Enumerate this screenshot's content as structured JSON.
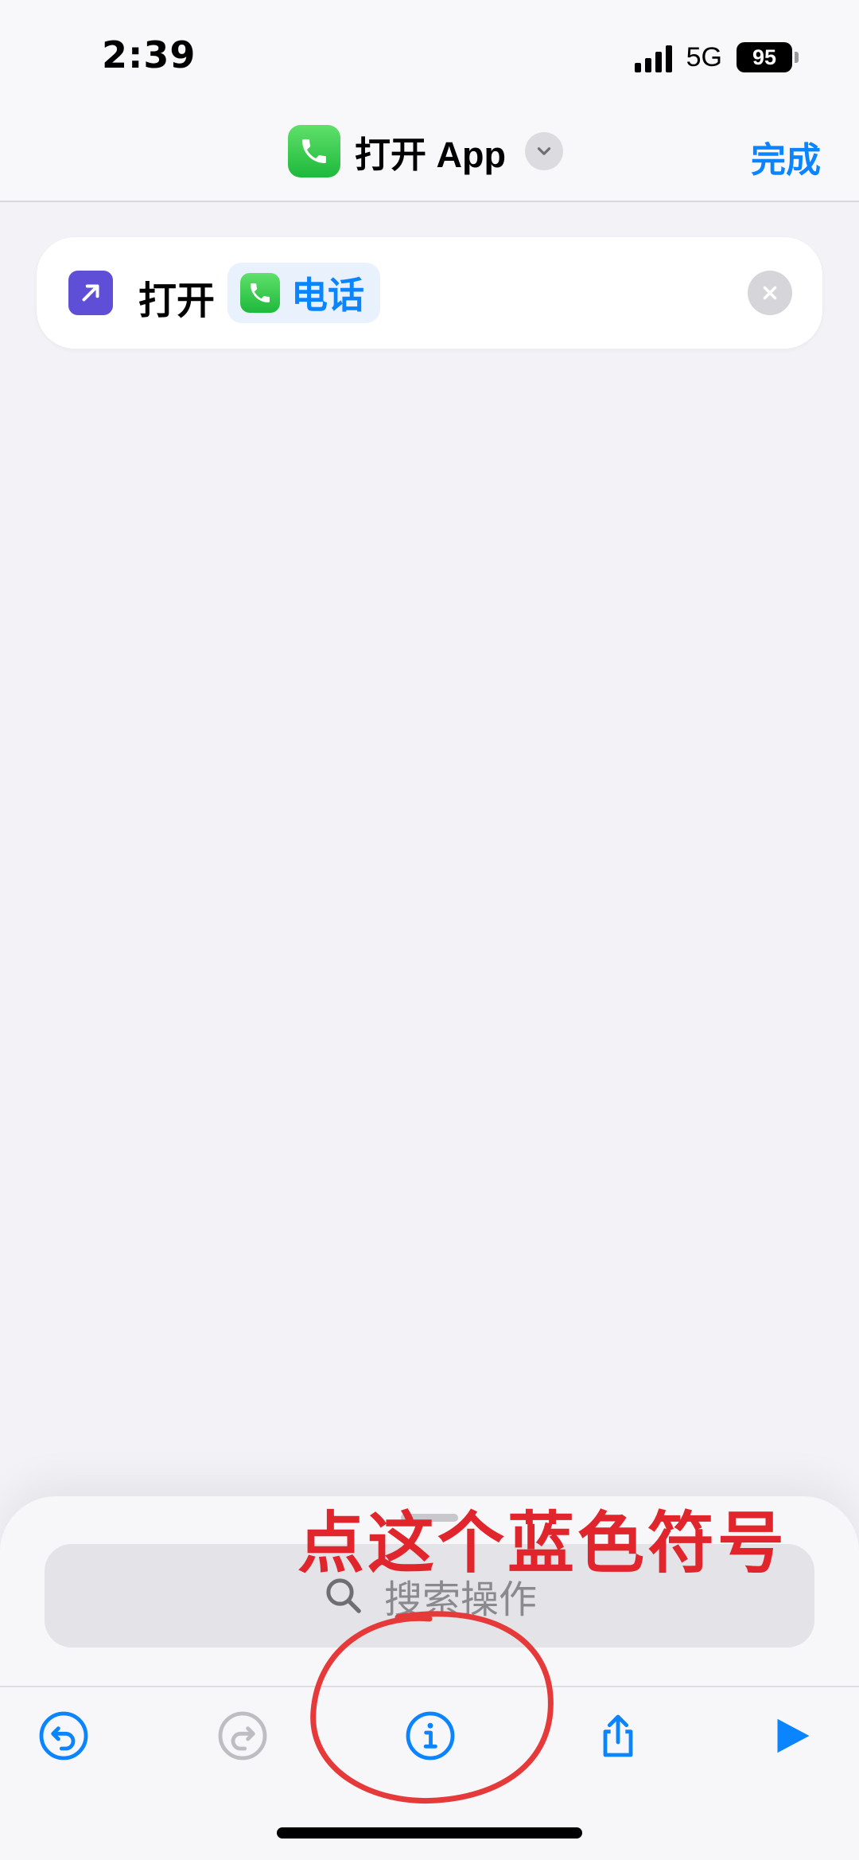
{
  "status_bar": {
    "time": "2:39",
    "network": "5G",
    "battery": "95"
  },
  "nav": {
    "title": "打开 App",
    "done_label": "完成",
    "app_icon": "phone-icon",
    "chevron_icon": "chevron-down-icon"
  },
  "action": {
    "verb": "打开",
    "app_name": "电话",
    "action_icon": "arrow-up-right-icon",
    "clear_icon": "close-icon"
  },
  "search": {
    "placeholder": "搜索操作",
    "icon": "search-icon"
  },
  "toolbar": {
    "buttons": [
      {
        "name": "undo-icon",
        "enabled": true
      },
      {
        "name": "redo-icon",
        "enabled": false
      },
      {
        "name": "info-icon",
        "enabled": true
      },
      {
        "name": "share-icon",
        "enabled": true
      },
      {
        "name": "play-icon",
        "enabled": true
      }
    ]
  },
  "annotation": {
    "text": "点这个蓝色符号",
    "color": "#E0262C"
  },
  "colors": {
    "accent": "#0A84FF",
    "phone_green": "#34C759",
    "action_purple": "#5E4FD6",
    "background": "#F2F2F7"
  }
}
